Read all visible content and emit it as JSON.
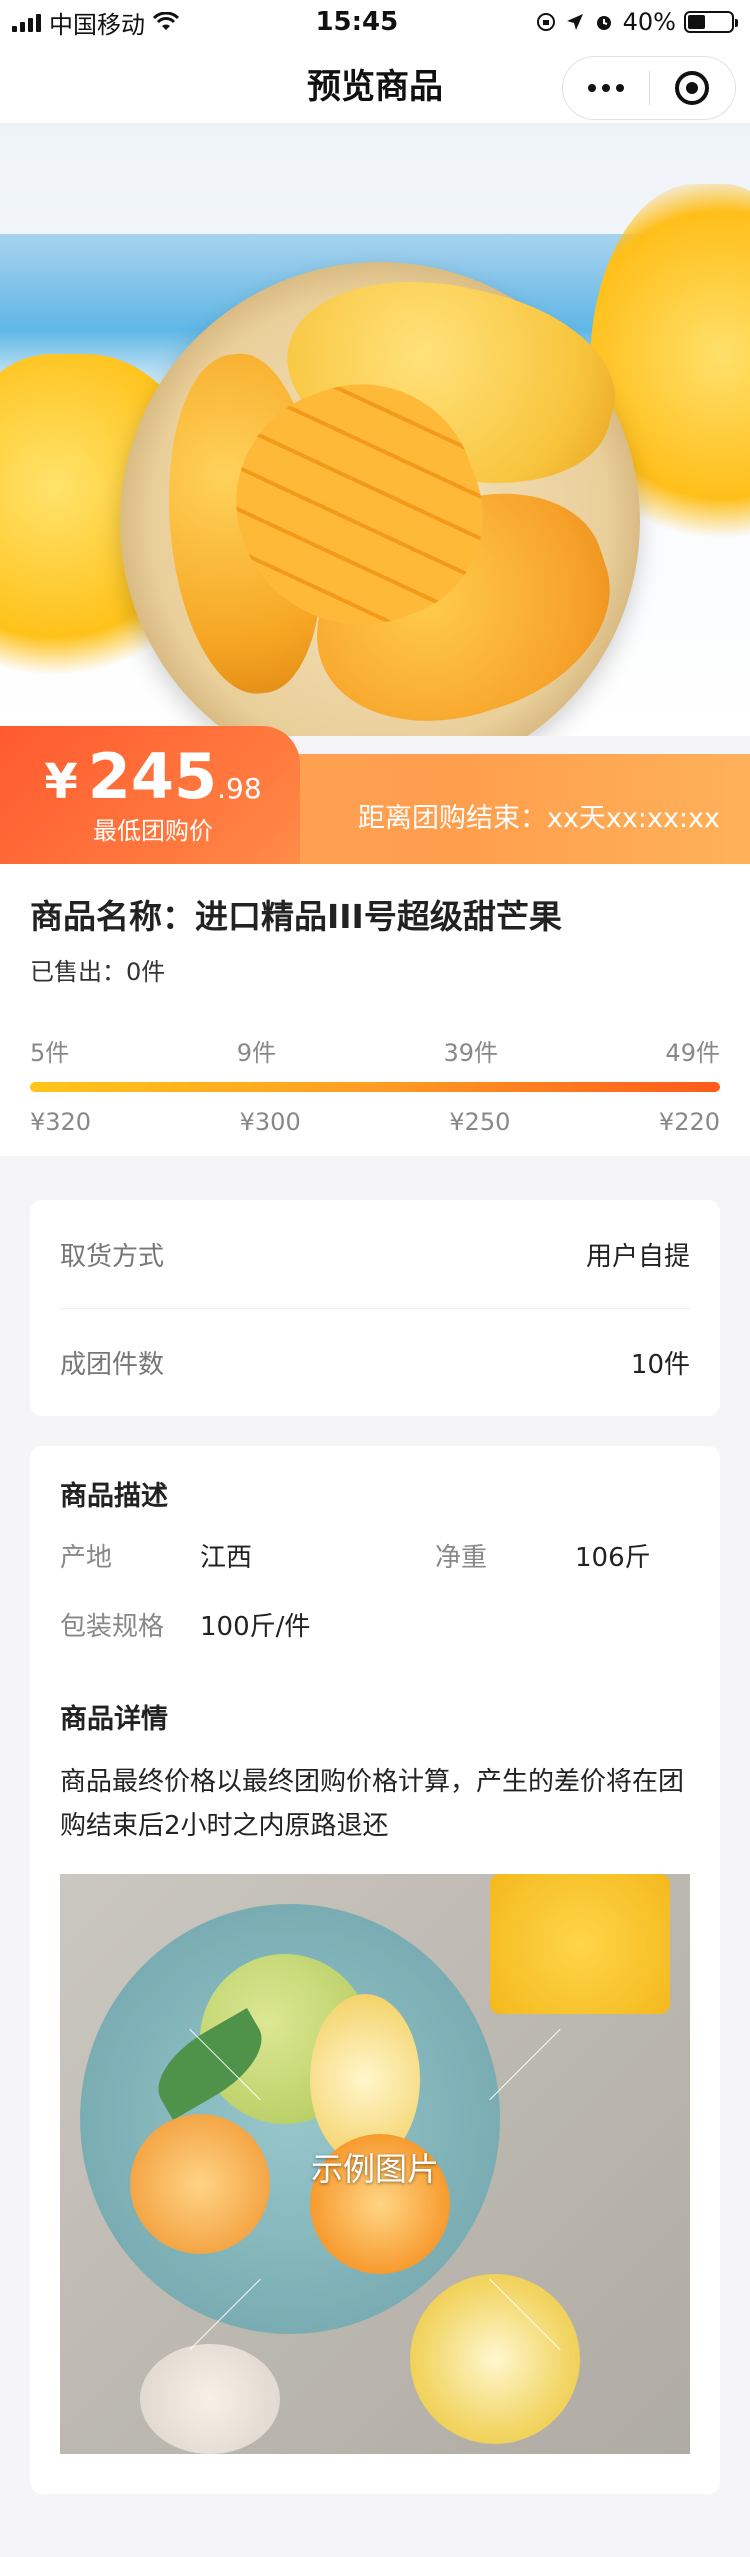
{
  "status_bar": {
    "carrier": "中国移动",
    "time": "15:45",
    "battery": "40%",
    "battery_level": 0.4,
    "icons": [
      "signal-icon",
      "wifi-icon",
      "rotation-lock-icon",
      "location-icon",
      "alarm-icon",
      "battery-icon"
    ]
  },
  "nav": {
    "title": "预览商品",
    "icons": [
      "more-icon",
      "close-miniprogram-icon"
    ]
  },
  "hero": {
    "image_name": "mango-hero-image"
  },
  "price": {
    "currency": "¥",
    "integer": "245",
    "decimal": ".98",
    "note": "最低团购价",
    "countdown": "距离团购结束：xx天xx:xx:xx"
  },
  "product": {
    "name": "商品名称：进口精品III号超级甜芒果",
    "sold": "已售出：0件"
  },
  "tiers": {
    "quantities": [
      "5件",
      "9件",
      "39件",
      "49件"
    ],
    "prices": [
      "¥320",
      "¥300",
      "¥250",
      "¥220"
    ]
  },
  "pickup_card": {
    "rows": [
      {
        "key": "取货方式",
        "value": "用户自提"
      },
      {
        "key": "成团件数",
        "value": "10件"
      }
    ]
  },
  "description": {
    "title": "商品描述",
    "origin_key": "产地",
    "origin_value": "江西",
    "weight_key": "净重",
    "weight_value": "106斤",
    "package_key": "包装规格",
    "package_value": "100斤/件"
  },
  "details": {
    "title": "商品详情",
    "text": "商品最终价格以最终团购价格计算，产生的差价将在团购结束后2小时之内原路退还",
    "example_label": "示例图片"
  },
  "colors": {
    "accent": "#ff5a2e",
    "banner": "#ffa35a",
    "bar_start": "#ffc51a",
    "bar_end": "#ff5a1a"
  }
}
